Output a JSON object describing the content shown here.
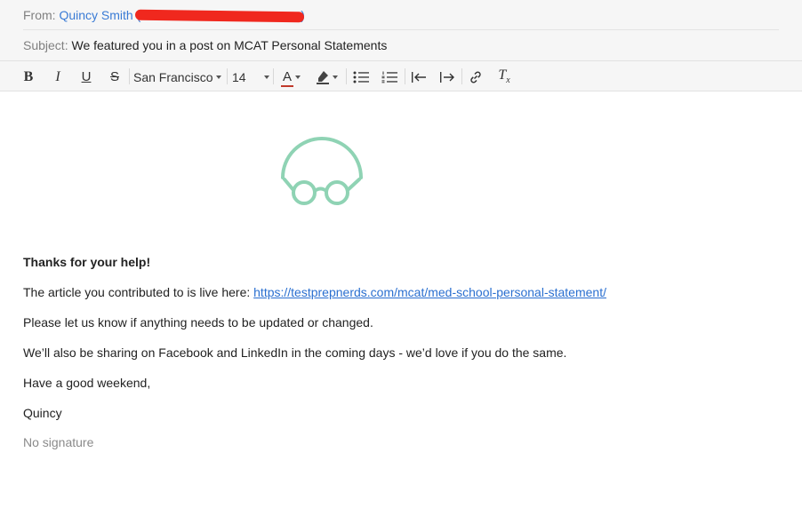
{
  "header": {
    "from_label": "From:",
    "from_name": "Quincy Smith",
    "from_email_open": "(",
    "from_email_close": ")",
    "subject_label": "Subject:",
    "subject_value": "We featured you in a post on MCAT Personal Statements"
  },
  "toolbar": {
    "bold": "B",
    "italic": "I",
    "underline": "U",
    "strike": "S",
    "font_family": "San Francisco",
    "font_size": "14",
    "text_color_glyph": "A",
    "text_color": "#c0392b",
    "clear_format_glyph": "T",
    "clear_format_sub": "x"
  },
  "logo": {
    "icon": "glasses-logo-icon",
    "color": "#8fd3b4"
  },
  "message": {
    "greeting": "Thanks for your help!",
    "line1_prefix": "The article you contributed to is live here: ",
    "line1_link": "https://testprepnerds.com/mcat/med-school-personal-statement/",
    "line2": "Please let us know if anything needs to be updated or changed.",
    "line3": "We’ll also be sharing on Facebook and LinkedIn in the coming days - we’d love if you do the same.",
    "line4": "Have a good weekend,",
    "signoff": "Quincy",
    "signature": "No signature"
  }
}
